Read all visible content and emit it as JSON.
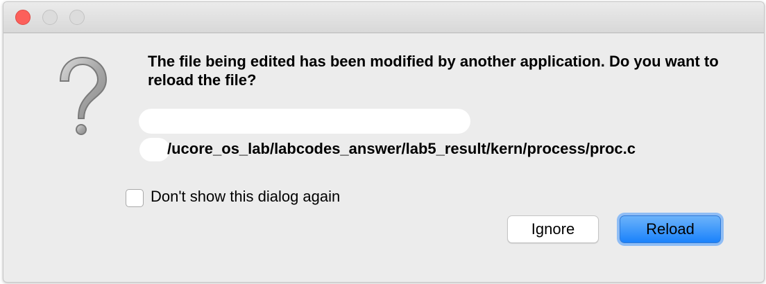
{
  "window": {
    "controls": {
      "close": "close-button",
      "minimize": "minimize-button",
      "zoom": "zoom-button"
    }
  },
  "dialog": {
    "icon": "question-mark-icon",
    "message": "The file being edited has been modified by another application. Do you want to reload the file?",
    "file_path": "/ucore_os_lab/labcodes_answer/lab5_result/kern/process/proc.c",
    "checkbox_label": "Don't show this dialog again",
    "checkbox_checked": false,
    "buttons": {
      "ignore": "Ignore",
      "reload": "Reload"
    }
  },
  "colors": {
    "close_light": "#fc605b",
    "default_button": "#1a82fb",
    "dialog_bg": "#ececec"
  }
}
